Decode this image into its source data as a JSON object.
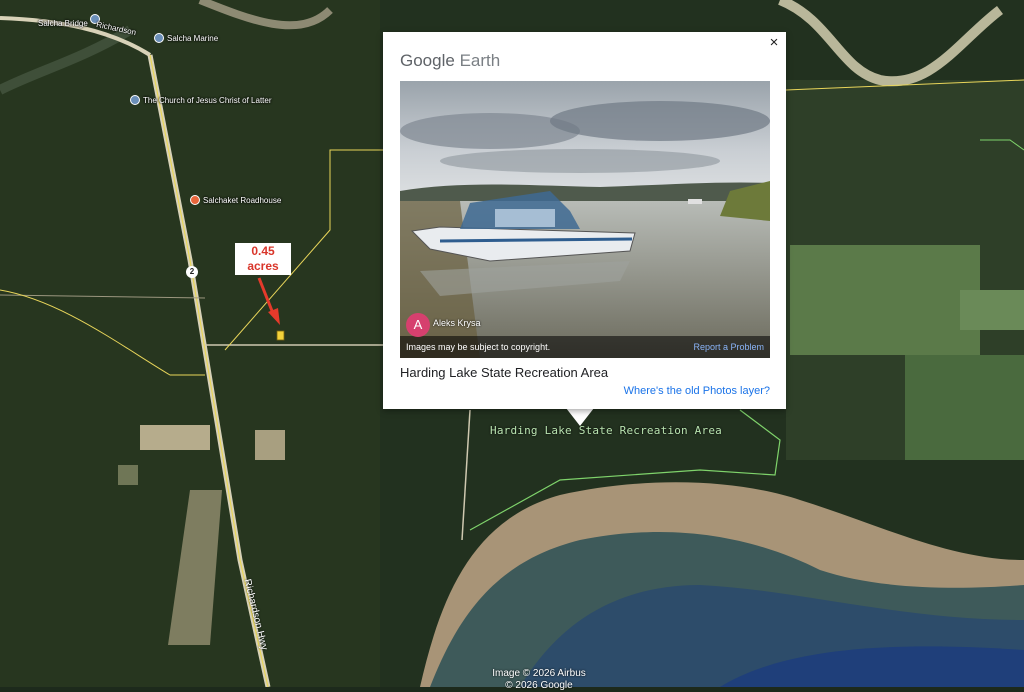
{
  "map": {
    "places": [
      {
        "name": "Salcha Bridge",
        "pin": "pin-icon"
      },
      {
        "name": "Salcha Marine",
        "pin": "pin-icon"
      },
      {
        "name": "The Church of Jesus Christ of Latter",
        "pin": "pin-icon"
      },
      {
        "name": "Salchaket Roadhouse",
        "pin": "restaurant-pin-icon"
      }
    ],
    "road_top_label": "Richardson",
    "road_label": "Richardson Hwy",
    "route_shield": "2",
    "area_label": "Harding Lake State Recreation Area",
    "acre_label_line1": "0.45",
    "acre_label_line2": "acres",
    "attribution_line1": "Image © 2026 Airbus",
    "attribution_line2": "© 2026 Google",
    "colors": {
      "acre_text": "#d9362b",
      "arrow": "#e53a2b",
      "boundary": "#7fd36b",
      "route_line": "#e8d55a"
    }
  },
  "popup": {
    "brand_google": "Google",
    "brand_earth": "Earth",
    "close_label": "×",
    "photo": {
      "author_initial": "A",
      "author_name": "Aleks Krysa",
      "copyright": "Images may be subject to copyright.",
      "report": "Report a Problem"
    },
    "title": "Harding Lake State Recreation Area",
    "old_photos_link": "Where's the old Photos layer?"
  }
}
